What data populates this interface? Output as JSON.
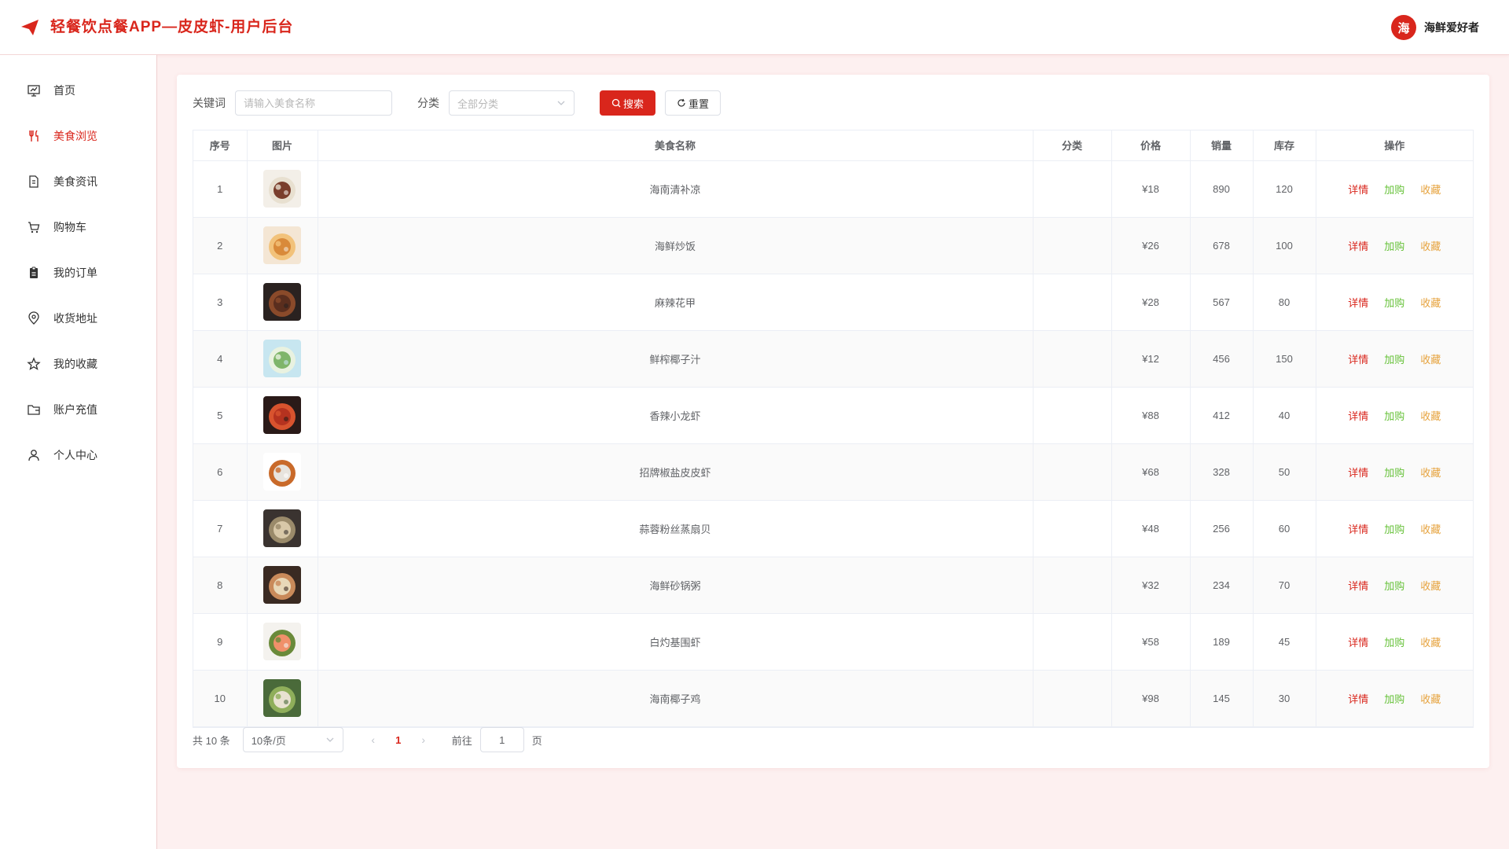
{
  "header": {
    "title": "轻餐饮点餐APP—皮皮虾-用户后台",
    "avatar_text": "海",
    "username": "海鲜爱好者"
  },
  "colors": {
    "accent": "#d9261c",
    "add": "#67c23a",
    "fav": "#e6a23c"
  },
  "sidebar": {
    "items": [
      {
        "label": "首页",
        "icon": "dashboard-icon",
        "active": false
      },
      {
        "label": "美食浏览",
        "icon": "fork-knife-icon",
        "active": true
      },
      {
        "label": "美食资讯",
        "icon": "document-icon",
        "active": false
      },
      {
        "label": "购物车",
        "icon": "cart-icon",
        "active": false
      },
      {
        "label": "我的订单",
        "icon": "clipboard-icon",
        "active": false
      },
      {
        "label": "收货地址",
        "icon": "location-icon",
        "active": false
      },
      {
        "label": "我的收藏",
        "icon": "star-icon",
        "active": false
      },
      {
        "label": "账户充值",
        "icon": "folder-icon",
        "active": false
      },
      {
        "label": "个人中心",
        "icon": "user-icon",
        "active": false
      }
    ]
  },
  "filter": {
    "keyword_label": "关键词",
    "keyword_placeholder": "请输入美食名称",
    "keyword_value": "",
    "category_label": "分类",
    "category_placeholder": "全部分类",
    "search_label": "搜索",
    "reset_label": "重置"
  },
  "table": {
    "columns": [
      "序号",
      "图片",
      "美食名称",
      "分类",
      "价格",
      "销量",
      "库存",
      "操作"
    ],
    "actions": {
      "detail": "详情",
      "add": "加购",
      "fav": "收藏"
    },
    "rows": [
      {
        "no": "1",
        "name": "海南清补凉",
        "category": "",
        "price": "¥18",
        "sales": "890",
        "stock": "120",
        "img": [
          "#f3efe8",
          "#7a3e2c",
          "#e8e0d0"
        ]
      },
      {
        "no": "2",
        "name": "海鲜炒饭",
        "category": "",
        "price": "¥26",
        "sales": "678",
        "stock": "100",
        "img": [
          "#f4e6d4",
          "#d98a3a",
          "#f2c27a"
        ]
      },
      {
        "no": "3",
        "name": "麻辣花甲",
        "category": "",
        "price": "¥28",
        "sales": "567",
        "stock": "80",
        "img": [
          "#2a2220",
          "#5a2e1e",
          "#8a4a2a"
        ]
      },
      {
        "no": "4",
        "name": "鲜榨椰子汁",
        "category": "",
        "price": "¥12",
        "sales": "456",
        "stock": "150",
        "img": [
          "#c7e6f0",
          "#7fb56a",
          "#e9f2e0"
        ]
      },
      {
        "no": "5",
        "name": "香辣小龙虾",
        "category": "",
        "price": "¥88",
        "sales": "412",
        "stock": "40",
        "img": [
          "#2a1a18",
          "#b5321f",
          "#d8532e"
        ]
      },
      {
        "no": "6",
        "name": "招牌椒盐皮皮虾",
        "category": "",
        "price": "¥68",
        "sales": "328",
        "stock": "50",
        "img": [
          "#ffffff",
          "#e8e4de",
          "#c96a2a"
        ]
      },
      {
        "no": "7",
        "name": "蒜蓉粉丝蒸扇贝",
        "category": "",
        "price": "¥48",
        "sales": "256",
        "stock": "60",
        "img": [
          "#3a3330",
          "#d8c8a8",
          "#9a8a6a"
        ]
      },
      {
        "no": "8",
        "name": "海鲜砂锅粥",
        "category": "",
        "price": "¥32",
        "sales": "234",
        "stock": "70",
        "img": [
          "#3a2a22",
          "#e8d8b8",
          "#c98a5a"
        ]
      },
      {
        "no": "9",
        "name": "白灼基围虾",
        "category": "",
        "price": "¥58",
        "sales": "189",
        "stock": "45",
        "img": [
          "#f4f2ee",
          "#f0906a",
          "#6a8a3a"
        ]
      },
      {
        "no": "10",
        "name": "海南椰子鸡",
        "category": "",
        "price": "¥98",
        "sales": "145",
        "stock": "30",
        "img": [
          "#4a6a3a",
          "#e8e2d0",
          "#8fae5a"
        ]
      }
    ]
  },
  "pagination": {
    "total_text": "共 10 条",
    "page_size": "10条/页",
    "prev": "‹",
    "next": "›",
    "current_page": "1",
    "goto_label": "前往",
    "goto_value": "1",
    "page_suffix": "页"
  }
}
